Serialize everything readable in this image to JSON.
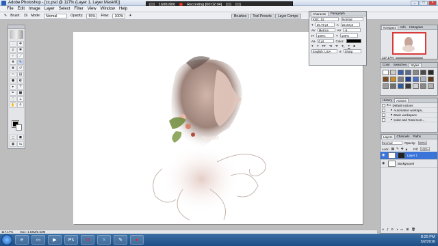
{
  "window": {
    "title": "Adobe Photoshop - [cc.psd @ 117% (Layer 1, Layer Mask/8)]"
  },
  "recorder": {
    "resolution": "1600x900",
    "status": "Recording [00:02:04]"
  },
  "menu": [
    "File",
    "Edit",
    "Image",
    "Layer",
    "Select",
    "Filter",
    "View",
    "Window",
    "Help"
  ],
  "options": {
    "brush_label": "Brush:",
    "brush_size": "19",
    "mode_label": "Mode:",
    "mode_value": "Normal",
    "opacity_label": "Opacity:",
    "opacity_value": "55%",
    "flow_label": "Flow:",
    "flow_value": "100%"
  },
  "panel_tabs": [
    "Brushes",
    "Tool Presets",
    "Layer Comps"
  ],
  "character": {
    "tabs": [
      "Character",
      "Paragraph"
    ],
    "font": "KBC_02",
    "style": "Normal",
    "size": "26.78 pt",
    "leading": "22.23 pt",
    "kerning": "Metrics",
    "tracking": "-5",
    "vscale": "100%",
    "hscale": "100%",
    "baseline": "0 pt",
    "color_label": "Color:",
    "language": "English: USA",
    "aa": "a",
    "aa_value": "Sharp"
  },
  "navigator": {
    "tabs": [
      "Navigator",
      "Info",
      "Histogram"
    ],
    "zoom": "117.17%"
  },
  "styles": {
    "tabs": [
      "Color",
      "Swatches",
      "Styles"
    ]
  },
  "actions": {
    "tabs": [
      "History",
      "Actions"
    ],
    "items": [
      "Default Actions",
      "Automation workspa...",
      "Basic workspace",
      "Color and Tonal Corr..."
    ]
  },
  "layers": {
    "tabs": [
      "Layers",
      "Channels",
      "Paths"
    ],
    "blend": "Normal",
    "opacity_label": "Opacity:",
    "opacity": "100%",
    "lock_label": "Lock:",
    "fill_label": "Fill:",
    "fill": "100%",
    "items": [
      {
        "name": "Layer 1",
        "selected": true
      },
      {
        "name": "Background",
        "selected": false
      }
    ]
  },
  "status": {
    "zoom": "117.17%",
    "doc": "Doc: 1.84M/2.62M"
  },
  "clock": {
    "time": "8:25 PM",
    "date": "5/2/2016"
  }
}
